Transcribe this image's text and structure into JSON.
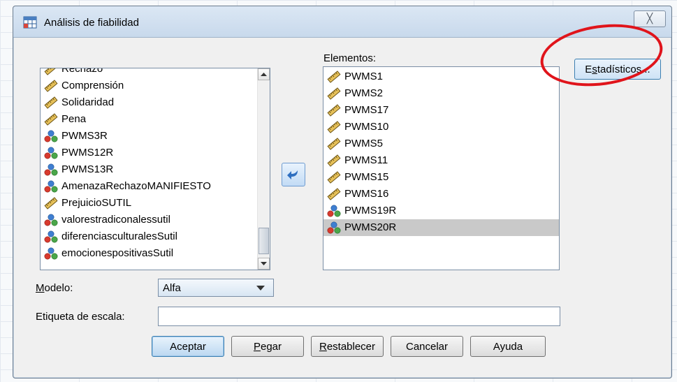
{
  "window": {
    "title": "Análisis de fiabilidad",
    "close_glyph": "╳"
  },
  "source_list": {
    "items": [
      {
        "label": "Rechazo",
        "icon": "ruler-icon"
      },
      {
        "label": "Comprensión",
        "icon": "ruler-icon"
      },
      {
        "label": "Solidaridad",
        "icon": "ruler-icon"
      },
      {
        "label": "Pena",
        "icon": "ruler-icon"
      },
      {
        "label": "PWMS3R",
        "icon": "nominal-icon"
      },
      {
        "label": "PWMS12R",
        "icon": "nominal-icon"
      },
      {
        "label": "PWMS13R",
        "icon": "nominal-icon"
      },
      {
        "label": "AmenazaRechazoMANIFIESTO",
        "icon": "nominal-icon"
      },
      {
        "label": "PrejuicioSUTIL",
        "icon": "ruler-icon"
      },
      {
        "label": "valorestradiconalessutil",
        "icon": "nominal-icon"
      },
      {
        "label": "diferenciasculturalesSutil",
        "icon": "nominal-icon"
      },
      {
        "label": "emocionespositivasSutil",
        "icon": "nominal-icon"
      }
    ]
  },
  "items_panel": {
    "label": "Elementos:",
    "items": [
      {
        "label": "PWMS1",
        "icon": "ruler-icon"
      },
      {
        "label": "PWMS2",
        "icon": "ruler-icon"
      },
      {
        "label": "PWMS17",
        "icon": "ruler-icon"
      },
      {
        "label": "PWMS10",
        "icon": "ruler-icon"
      },
      {
        "label": "PWMS5",
        "icon": "ruler-icon"
      },
      {
        "label": "PWMS11",
        "icon": "ruler-icon"
      },
      {
        "label": "PWMS15",
        "icon": "ruler-icon"
      },
      {
        "label": "PWMS16",
        "icon": "ruler-icon"
      },
      {
        "label": "PWMS19R",
        "icon": "nominal-icon"
      },
      {
        "label": "PWMS20R",
        "icon": "nominal-icon",
        "selected": true
      }
    ]
  },
  "statistics_button": {
    "pre": "E",
    "accel": "s",
    "post": "tadísticos..."
  },
  "model": {
    "label_accel": "M",
    "label_rest": "odelo:",
    "selected": "Alfa"
  },
  "scale_label": {
    "label": "Etiqueta de escala:",
    "value": ""
  },
  "buttons": {
    "accept": "Aceptar",
    "paste_accel": "P",
    "paste_rest": "egar",
    "reset_accel": "R",
    "reset_rest": "establecer",
    "cancel": "Cancelar",
    "help": "Ayuda"
  },
  "colors": {
    "annotation": "#e0141b",
    "selected_row": "#c9c9c9"
  }
}
